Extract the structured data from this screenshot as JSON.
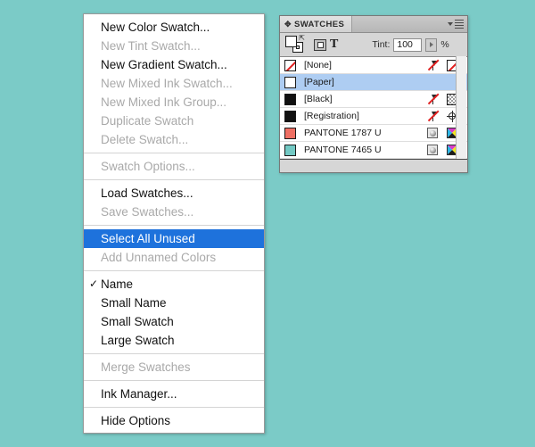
{
  "background_color": "#7bcbc7",
  "context_menu": {
    "name": "swatches-panel-menu",
    "highlight_color": "#1e72dc",
    "groups": [
      {
        "items": [
          {
            "label": "New Color Swatch...",
            "enabled": true,
            "checked": false,
            "highlighted": false
          },
          {
            "label": "New Tint Swatch...",
            "enabled": false,
            "checked": false,
            "highlighted": false
          },
          {
            "label": "New Gradient Swatch...",
            "enabled": true,
            "checked": false,
            "highlighted": false
          },
          {
            "label": "New Mixed Ink Swatch...",
            "enabled": false,
            "checked": false,
            "highlighted": false
          },
          {
            "label": "New Mixed Ink Group...",
            "enabled": false,
            "checked": false,
            "highlighted": false
          },
          {
            "label": "Duplicate Swatch",
            "enabled": false,
            "checked": false,
            "highlighted": false
          },
          {
            "label": "Delete Swatch...",
            "enabled": false,
            "checked": false,
            "highlighted": false
          }
        ]
      },
      {
        "items": [
          {
            "label": "Swatch Options...",
            "enabled": false,
            "checked": false,
            "highlighted": false
          }
        ]
      },
      {
        "items": [
          {
            "label": "Load Swatches...",
            "enabled": true,
            "checked": false,
            "highlighted": false
          },
          {
            "label": "Save Swatches...",
            "enabled": false,
            "checked": false,
            "highlighted": false
          }
        ]
      },
      {
        "items": [
          {
            "label": "Select All Unused",
            "enabled": true,
            "checked": false,
            "highlighted": true
          },
          {
            "label": "Add Unnamed Colors",
            "enabled": false,
            "checked": false,
            "highlighted": false
          }
        ]
      },
      {
        "items": [
          {
            "label": "Name",
            "enabled": true,
            "checked": true,
            "highlighted": false
          },
          {
            "label": "Small Name",
            "enabled": true,
            "checked": false,
            "highlighted": false
          },
          {
            "label": "Small Swatch",
            "enabled": true,
            "checked": false,
            "highlighted": false
          },
          {
            "label": "Large Swatch",
            "enabled": true,
            "checked": false,
            "highlighted": false
          }
        ]
      },
      {
        "items": [
          {
            "label": "Merge Swatches",
            "enabled": false,
            "checked": false,
            "highlighted": false
          }
        ]
      },
      {
        "items": [
          {
            "label": "Ink Manager...",
            "enabled": true,
            "checked": false,
            "highlighted": false
          }
        ]
      },
      {
        "items": [
          {
            "label": "Hide Options",
            "enabled": true,
            "checked": false,
            "highlighted": false
          }
        ]
      }
    ],
    "check_glyph": "✓"
  },
  "panel": {
    "tab_title": "SWATCHES",
    "tab_grip_glyph": "✥",
    "toolbar": {
      "tint_label": "Tint:",
      "tint_value": "100",
      "tint_unit": "%",
      "text_format_glyph": "T"
    },
    "swatches": [
      {
        "name": "[None]",
        "color": "#ffffff",
        "chip_type": "none",
        "selected": false,
        "icons": [
          "spot-pen-icon",
          "none-color-icon"
        ]
      },
      {
        "name": "[Paper]",
        "color": "#ffffff",
        "chip_type": "solid",
        "selected": true,
        "icons": []
      },
      {
        "name": "[Black]",
        "color": "#111111",
        "chip_type": "solid",
        "selected": false,
        "icons": [
          "spot-pen-icon",
          "checkerboard-icon"
        ]
      },
      {
        "name": "[Registration]",
        "color": "#111111",
        "chip_type": "solid",
        "selected": false,
        "icons": [
          "spot-pen-icon",
          "registration-target-icon"
        ]
      },
      {
        "name": "PANTONE 1787 U",
        "color": "#ef6f63",
        "chip_type": "solid",
        "selected": false,
        "icons": [
          "spot-color-icon",
          "cmyk-icon"
        ]
      },
      {
        "name": "PANTONE 7465 U",
        "color": "#73c9c4",
        "chip_type": "solid",
        "selected": false,
        "icons": [
          "spot-color-icon",
          "cmyk-icon"
        ]
      }
    ]
  }
}
